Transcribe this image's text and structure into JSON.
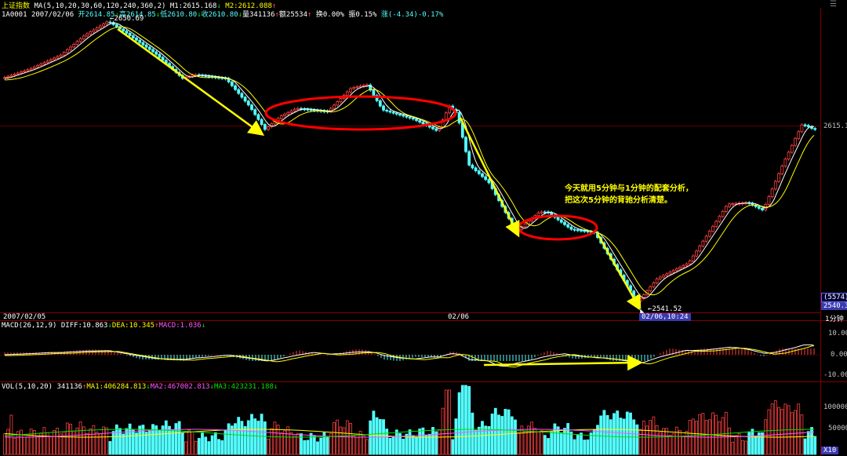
{
  "header": {
    "index_name": "上证指数",
    "ma_text": "MA(5,10,20,30,60,120,240,360,2)",
    "m1": "M1:2615.168",
    "m2": "M2:2612.088",
    "code": "1A0001",
    "date": "2007/02/06",
    "open": "开2614.85",
    "high": "高2614.85",
    "low": "低2610.80",
    "close": "收2610.80",
    "volume": "量341136",
    "amount": "额25534",
    "turnover": "换0.00%",
    "amplitude": "振0.15%",
    "change": "涨(-4.34)-0.17%"
  },
  "price_panel": {
    "peak_label": "2650.69",
    "trough_label": "2541.52",
    "current_price": "2615.1",
    "count_badge": "(5574)",
    "low_price_axis": "2540.30",
    "date_left": "2007/02/05",
    "date_mid": "02/06",
    "cursor_time": "02/06,10:24",
    "period": "1分钟",
    "annotation_line1": "今天就用5分钟与1分钟的配套分析，",
    "annotation_line2": "把这次5分钟的背驰分析清楚。"
  },
  "macd_panel": {
    "label": "MACD(26,12,9)",
    "diff": "DIFF:10.863",
    "dea": "DEA:10.345",
    "macd": "MACD:1.036",
    "axis_top": "10.00",
    "axis_mid": "0.00",
    "axis_bottom": "-10.00"
  },
  "vol_panel": {
    "label": "VOL(5,10,20)",
    "value": "341136",
    "ma1": "MA1:406284.813",
    "ma2": "MA2:467002.813",
    "ma3": "MA3:423231.188",
    "axis_top": "100000",
    "axis_mid": "50000",
    "unit": "X10"
  },
  "colors": {
    "up": "#ff4040",
    "down": "#54ffff",
    "ma_white": "#ffffff",
    "ma_yellow": "#ffff00",
    "arrow": "#ffff00",
    "ellipse": "#ff0000",
    "grid": "#800000"
  },
  "icons": {
    "up_arrow": "arrow-up-icon",
    "down_arrow": "arrow-down-icon",
    "window_menu": "window-menu-icon"
  },
  "chart_data": {
    "type": "candlestick",
    "period": "1分钟",
    "price_anchors": [
      {
        "label": "peak",
        "value": 2650.69
      },
      {
        "label": "trough",
        "value": 2541.52
      },
      {
        "label": "current",
        "value": 2615.1
      }
    ],
    "macd": {
      "diff": 10.863,
      "dea": 10.345,
      "macd": 1.036
    },
    "volume": {
      "value": 341136,
      "ma1": 406284.813,
      "ma2": 467002.813,
      "ma3": 423231.188
    }
  }
}
